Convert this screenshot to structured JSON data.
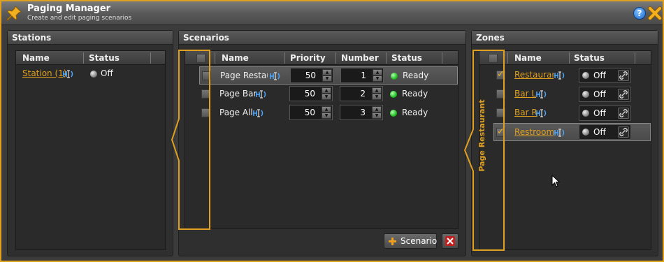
{
  "window": {
    "title": "Paging Manager",
    "subtitle": "Create and edit paging scenarios",
    "accent": "#e0a020"
  },
  "stations": {
    "title": "Stations",
    "columns": [
      "Name",
      "Status"
    ],
    "rows": [
      {
        "name": "Station (1)",
        "status": "Off"
      }
    ]
  },
  "scenarios": {
    "title": "Scenarios",
    "columns": [
      "Name",
      "Priority",
      "Number",
      "Status"
    ],
    "rows": [
      {
        "name": "Page Restaurant",
        "priority": "50",
        "number": "1",
        "status": "Ready"
      },
      {
        "name": "Page Bar",
        "priority": "50",
        "number": "2",
        "status": "Ready"
      },
      {
        "name": "Page All",
        "priority": "50",
        "number": "3",
        "status": "Ready"
      }
    ],
    "add_label": "Scenario"
  },
  "zones": {
    "title": "Zones",
    "columns": [
      "Name",
      "Status"
    ],
    "scenario_label": "Page Restaurant",
    "rows": [
      {
        "name": "Restaurant",
        "status": "Off",
        "checked": true
      },
      {
        "name": "Bar L",
        "status": "Off",
        "checked": false
      },
      {
        "name": "Bar R",
        "status": "Off",
        "checked": false
      },
      {
        "name": "Restrooms",
        "status": "Off",
        "checked": true
      }
    ]
  }
}
